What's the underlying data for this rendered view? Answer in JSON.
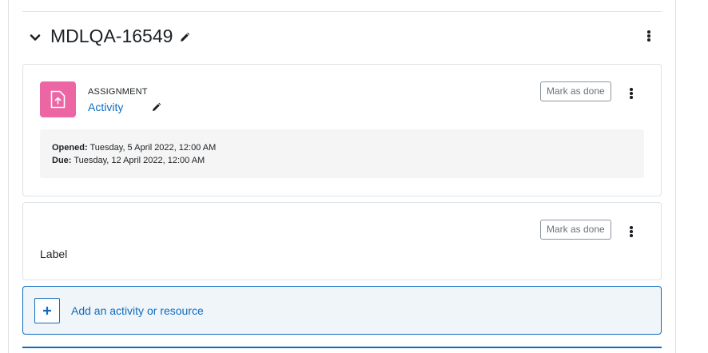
{
  "section": {
    "title": "MDLQA-16549",
    "collapse_icon": "chevron-down-icon",
    "edit_icon": "pencil-icon",
    "menu_icon": "kebab-vertical-icon"
  },
  "activities": [
    {
      "type_label": "ASSIGNMENT",
      "name": "Activity",
      "icon": "assignment-upload-icon",
      "icon_color": "#eb66a2",
      "mark_done_label": "Mark as done",
      "dates": {
        "opened_label": "Opened:",
        "opened_value": "Tuesday, 5 April 2022, 12:00 AM",
        "due_label": "Due:",
        "due_value": "Tuesday, 12 April 2022, 12:00 AM"
      }
    },
    {
      "text": "Label",
      "mark_done_label": "Mark as done"
    }
  ],
  "add_activity": {
    "label": "Add an activity or resource",
    "icon": "plus-icon"
  },
  "colors": {
    "link": "#0f6cbf",
    "assignment": "#eb66a2",
    "border": "#dee2e6"
  }
}
